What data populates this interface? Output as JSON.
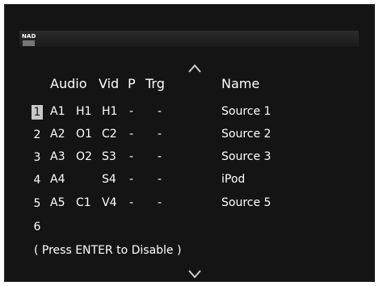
{
  "header": {
    "brand": "NAD"
  },
  "columns": {
    "audio": "Audio",
    "vid": "Vid",
    "p": "P",
    "trg": "Trg",
    "name": "Name"
  },
  "rows": [
    {
      "num": "1",
      "audio": "A1",
      "input": "H1",
      "vid": "H1",
      "p": "-",
      "trg": "-",
      "name": "Source 1",
      "selected": true
    },
    {
      "num": "2",
      "audio": "A2",
      "input": "O1",
      "vid": "C2",
      "p": "-",
      "trg": "-",
      "name": "Source 2"
    },
    {
      "num": "3",
      "audio": "A3",
      "input": "O2",
      "vid": "S3",
      "p": "-",
      "trg": "-",
      "name": "Source 3"
    },
    {
      "num": "4",
      "audio": "A4",
      "input": "",
      "vid": "S4",
      "p": "-",
      "trg": "-",
      "name": "iPod"
    },
    {
      "num": "5",
      "audio": "A5",
      "input": "C1",
      "vid": "V4",
      "p": "-",
      "trg": "-",
      "name": "Source 5"
    },
    {
      "num": "6",
      "audio": "",
      "input": "",
      "vid": "",
      "p": "",
      "trg": "",
      "name": ""
    }
  ],
  "hint": "( Press ENTER to Disable )",
  "icons": {
    "up": "chevron-up-icon",
    "down": "chevron-down-icon"
  },
  "colors": {
    "background": "#141414",
    "text": "#ffffff",
    "selection": "#c8c8c8"
  }
}
